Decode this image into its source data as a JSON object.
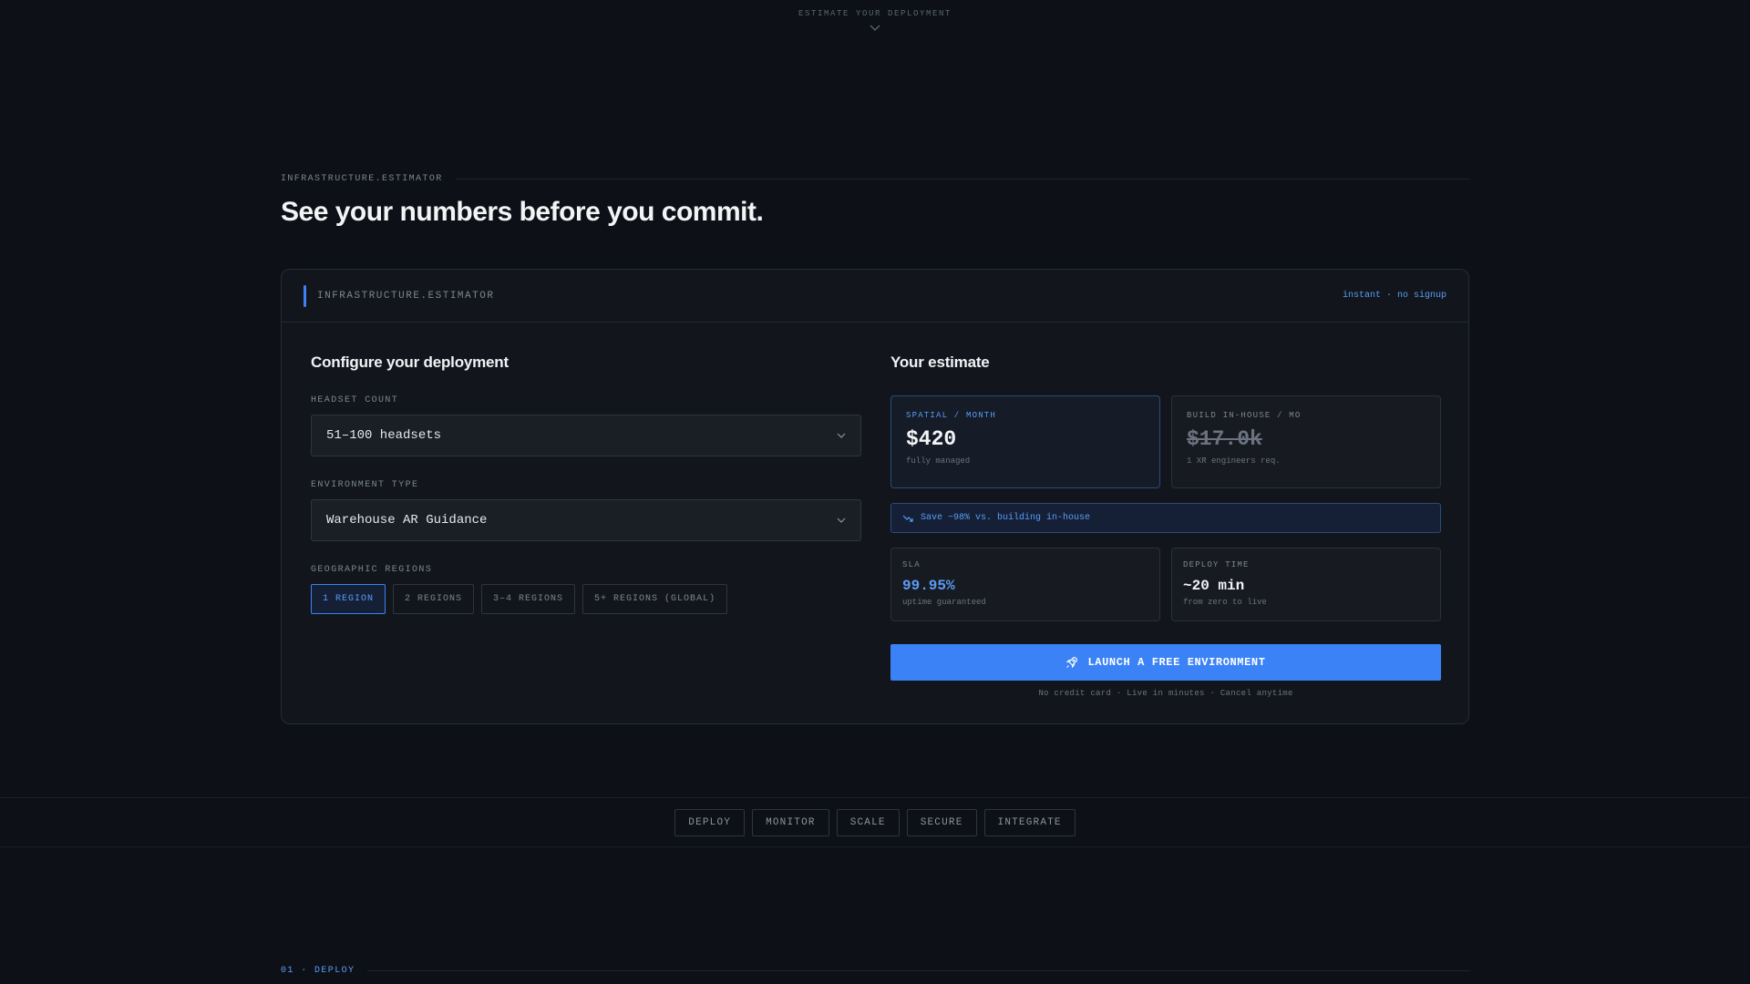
{
  "scroll_hint": {
    "label": "ESTIMATE YOUR DEPLOYMENT",
    "icon": "chevron-down-icon"
  },
  "section": {
    "eyebrow": "INFRASTRUCTURE.ESTIMATOR",
    "title": "See your numbers before you commit."
  },
  "card": {
    "header_label": "INFRASTRUCTURE.ESTIMATOR",
    "header_right": "instant · no signup",
    "accent_color": "#3b82f6"
  },
  "config": {
    "title": "Configure your deployment",
    "headset_label": "HEADSET COUNT",
    "headset_value": "51–100 headsets",
    "environment_label": "ENVIRONMENT TYPE",
    "environment_value": "Warehouse AR Guidance",
    "regions_label": "GEOGRAPHIC REGIONS",
    "regions": [
      "1 REGION",
      "2 REGIONS",
      "3–4 REGIONS",
      "5+ REGIONS (GLOBAL)"
    ],
    "selected_region": "1 REGION"
  },
  "estimate": {
    "title": "Your estimate",
    "spatial": {
      "label": "SPATIAL / MONTH",
      "value": "$420",
      "sub": "fully managed"
    },
    "inhouse": {
      "label": "BUILD IN-HOUSE / MO",
      "value": "$17.0k",
      "sub": "1 XR engineers req."
    },
    "savings": "Save ~98% vs. building in-house",
    "sla": {
      "label": "SLA",
      "value": "99.95%",
      "sub": "uptime guaranteed"
    },
    "deploy": {
      "label": "DEPLOY TIME",
      "value": "~20 min",
      "sub": "from zero to live"
    },
    "cta": "LAUNCH A FREE ENVIRONMENT",
    "cta_note": "No credit card · Live in minutes · Cancel anytime"
  },
  "nav": [
    "DEPLOY",
    "MONITOR",
    "SCALE",
    "SECURE",
    "INTEGRATE"
  ],
  "footer_eyebrow": "01 · DEPLOY"
}
